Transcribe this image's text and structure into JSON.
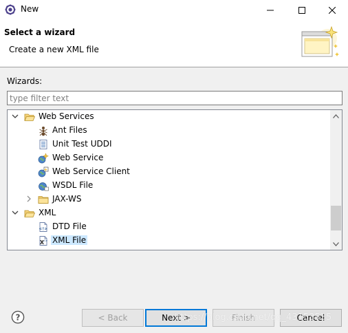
{
  "window": {
    "title": "New",
    "app_icon": "eclipse-icon",
    "controls": [
      "minimize-icon",
      "maximize-icon",
      "close-icon"
    ]
  },
  "banner": {
    "title": "Select a wizard",
    "description": "Create a new XML file",
    "graphic": "new-wizard-icon"
  },
  "wizards": {
    "label": "Wizards:",
    "filter_placeholder": "type filter text",
    "filter_value": "",
    "tree": [
      {
        "label": "Web Services",
        "level": 0,
        "expander": "expanded",
        "icon": "folder-open-icon"
      },
      {
        "label": "Ant Files",
        "level": 1,
        "icon": "ant-icon"
      },
      {
        "label": "Unit Test UDDI",
        "level": 1,
        "icon": "document-icon"
      },
      {
        "label": "Web Service",
        "level": 1,
        "icon": "web-service-icon"
      },
      {
        "label": "Web Service Client",
        "level": 1,
        "icon": "web-service-client-icon"
      },
      {
        "label": "WSDL File",
        "level": 1,
        "icon": "wsdl-file-icon"
      },
      {
        "label": "JAX-WS",
        "level": 1,
        "expander": "collapsed",
        "icon": "folder-icon"
      },
      {
        "label": "XML",
        "level": 0,
        "expander": "expanded",
        "icon": "folder-open-icon"
      },
      {
        "label": "DTD File",
        "level": 1,
        "icon": "dtd-file-icon"
      },
      {
        "label": "XML File",
        "level": 1,
        "icon": "xml-file-icon",
        "selected": true
      }
    ]
  },
  "buttons": {
    "help": "help-icon",
    "back": "< Back",
    "next": "Next >",
    "finish": "Finish",
    "cancel": "Cancel"
  },
  "watermark": "https://blog.csdn.net/qq_43153535"
}
